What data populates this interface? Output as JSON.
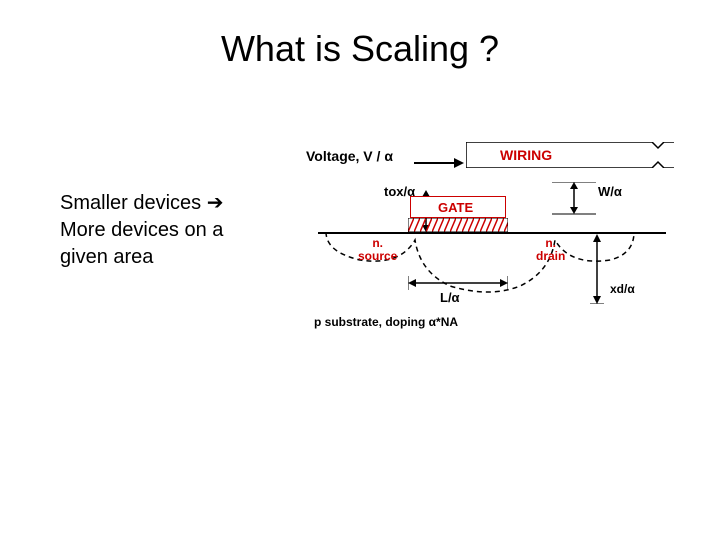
{
  "title": "What is Scaling ?",
  "subtitle": {
    "line1": "Smaller devices ➔",
    "line2": "More devices on a",
    "line3": "given area"
  },
  "diagram": {
    "voltage": "Voltage, V / α",
    "wiring": "WIRING",
    "tox": "tox/α",
    "gate": "GATE",
    "W": "W/α",
    "nsource_top": "n.",
    "nsource_bot": "source",
    "ndrain_top": "n.",
    "ndrain_bot": "drain",
    "L": "L/α",
    "substrate": "p substrate, doping   α*NA",
    "xd": "xd/α"
  }
}
